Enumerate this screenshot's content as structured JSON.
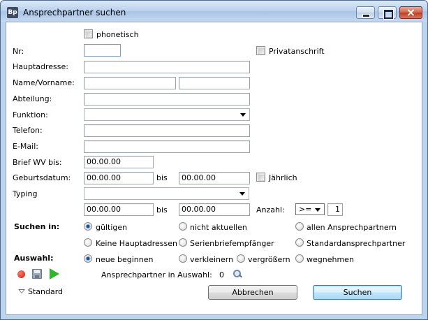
{
  "window": {
    "title": "Ansprechpartner suchen",
    "icon_text": "Bp"
  },
  "form": {
    "phonetisch_label": "phonetisch",
    "nr_label": "Nr:",
    "nr_value": "",
    "privatanschrift_label": "Privatanschrift",
    "hauptadresse_label": "Hauptadresse:",
    "hauptadresse_value": "",
    "name_vorname_label": "Name/Vorname:",
    "name_value": "",
    "vorname_value": "",
    "abteilung_label": "Abteilung:",
    "abteilung_value": "",
    "funktion_label": "Funktion:",
    "funktion_value": "",
    "telefon_label": "Telefon:",
    "telefon_value": "",
    "email_label": "E-Mail:",
    "email_value": "",
    "brief_wv_label": "Brief WV bis:",
    "brief_wv_value": "00.00.00",
    "geburtsdatum_label": "Geburtsdatum:",
    "geburtsdatum_from": "00.00.00",
    "bis_label": "bis",
    "geburtsdatum_to": "00.00.00",
    "jaehrlich_label": "Jährlich",
    "typing_label": "Typing",
    "typing_value": "",
    "typing_from": "00.00.00",
    "bis2_label": "bis",
    "typing_to": "00.00.00",
    "anzahl_label": "Anzahl:",
    "anzahl_operator": ">=",
    "anzahl_value": "1"
  },
  "suchen_in": {
    "label": "Suchen in:",
    "options": [
      {
        "label": "gültigen",
        "checked": true
      },
      {
        "label": "nicht aktuellen",
        "checked": false
      },
      {
        "label": "allen Ansprechpartnern",
        "checked": false
      },
      {
        "label": "Keine Hauptadressen",
        "checked": false
      },
      {
        "label": "Serienbriefempfänger",
        "checked": false
      },
      {
        "label": "Standardansprechpartner",
        "checked": false
      }
    ]
  },
  "auswahl": {
    "label": "Auswahl:",
    "options": [
      {
        "label": "neue beginnen",
        "checked": true
      },
      {
        "label": "verkleinern",
        "checked": false
      },
      {
        "label": "vergrößern",
        "checked": false
      },
      {
        "label": "wegnehmen",
        "checked": false
      }
    ],
    "count_label": "Ansprechpartner in Auswahl:",
    "count_value": "0"
  },
  "footer": {
    "standard_label": "Standard",
    "cancel_label": "Abbrechen",
    "search_label": "Suchen"
  },
  "icons": {
    "record": "record-icon",
    "save": "save-icon",
    "play": "play-icon",
    "search": "search-icon",
    "chevron": "chevron-down-icon"
  }
}
